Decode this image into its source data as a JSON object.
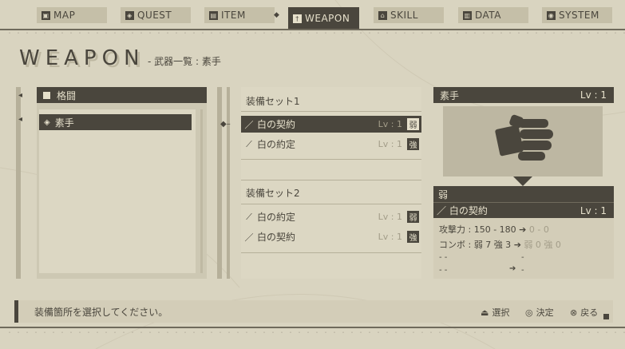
{
  "nav": {
    "tabs": [
      {
        "label": "MAP",
        "icon": "map-icon",
        "glyph": "▣"
      },
      {
        "label": "QUEST",
        "icon": "quest-icon",
        "glyph": "◈"
      },
      {
        "label": "ITEM",
        "icon": "item-icon",
        "glyph": "▤"
      },
      {
        "label": "WEAPON",
        "icon": "weapon-icon",
        "glyph": "†"
      },
      {
        "label": "SKILL",
        "icon": "skill-icon",
        "glyph": "⌂"
      },
      {
        "label": "DATA",
        "icon": "data-icon",
        "glyph": "▥"
      },
      {
        "label": "SYSTEM",
        "icon": "system-icon",
        "glyph": "◉"
      }
    ],
    "active": "WEAPON"
  },
  "title": {
    "main": "WEAPON",
    "sub": "- 武器一覧 : 素手"
  },
  "category": {
    "header": "格闘",
    "items": [
      {
        "label": "素手",
        "icon": "fist-icon"
      }
    ]
  },
  "sets": [
    {
      "label": "装備セット1",
      "weapons": [
        {
          "name": "白の契約",
          "lv": "Lv : 1",
          "grade": "弱",
          "icon": "sword-icon",
          "selected": true
        },
        {
          "name": "白の約定",
          "lv": "Lv : 1",
          "grade": "強",
          "icon": "spear-icon",
          "selected": false
        }
      ]
    },
    {
      "label": "装備セット2",
      "weapons": [
        {
          "name": "白の約定",
          "lv": "Lv : 1",
          "grade": "弱",
          "icon": "spear-icon",
          "selected": false
        },
        {
          "name": "白の契約",
          "lv": "Lv : 1",
          "grade": "強",
          "icon": "sword-icon",
          "selected": false
        }
      ]
    }
  ],
  "detail": {
    "header_name": "素手",
    "header_lv": "Lv : 1",
    "grade": "弱",
    "weapon_name": "白の契約",
    "weapon_lv": "Lv : 1",
    "attack_label": "攻撃力 : 150 - 180",
    "attack_new": "0 - 0",
    "combo_label": "コンボ : 弱 7  強 3",
    "combo_new_weak": "弱 0",
    "combo_new_strong": "強 0",
    "dash_left_1": "- -",
    "dash_left_2": "- -",
    "dash_right_1": "-",
    "dash_right_2": "-"
  },
  "bottom": {
    "message": "装備箇所を選択してください。",
    "hints": [
      {
        "label": "選択",
        "icon": "dpad-icon",
        "glyph": "⏏"
      },
      {
        "label": "決定",
        "icon": "circle-button-icon",
        "glyph": "◎"
      },
      {
        "label": "戻る",
        "icon": "cross-button-icon",
        "glyph": "⊗"
      }
    ]
  },
  "colors": {
    "background": "#d9d4c0",
    "dark": "#4a463d",
    "light_text": "#e6e0cb",
    "panel": "#dcd7c3"
  }
}
